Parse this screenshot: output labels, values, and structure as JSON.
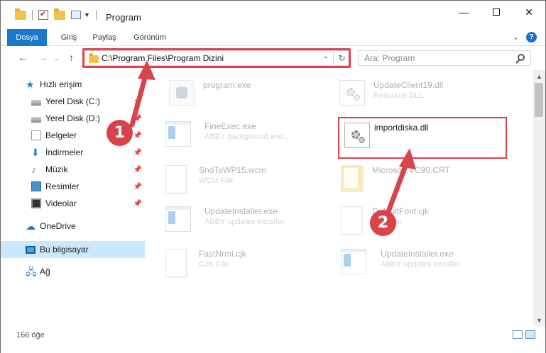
{
  "window": {
    "title": "Program",
    "min_glyph": "—",
    "close_glyph": "✕"
  },
  "ribbon": {
    "tabs": [
      "Dosya",
      "Giriş",
      "Paylaş",
      "Görünüm"
    ],
    "collapse_glyph": "⌄",
    "help_glyph": "?"
  },
  "nav": {
    "back_glyph": "←",
    "forward_glyph": "→",
    "recent_glyph": "⌄",
    "up_glyph": "↑",
    "address": "C:\\Program Files\\Program Dizini",
    "address_drop_glyph": "⌄",
    "refresh_glyph": "↻",
    "search_placeholder": "Ara: Program"
  },
  "sidebar": {
    "quick_access": "Hızlı erişim",
    "items": [
      {
        "label": "Yerel Disk (C:)",
        "icon": "disk-icon",
        "pinned": true
      },
      {
        "label": "Yerel Disk (D:)",
        "icon": "disk-icon",
        "pinned": true
      },
      {
        "label": "Belgeler",
        "icon": "documents-icon",
        "pinned": true
      },
      {
        "label": "İndirmeler",
        "icon": "download-icon",
        "pinned": true
      },
      {
        "label": "Müzik",
        "icon": "music-icon",
        "pinned": true
      },
      {
        "label": "Resimler",
        "icon": "pictures-icon",
        "pinned": true
      },
      {
        "label": "Videolar",
        "icon": "videos-icon",
        "pinned": true
      }
    ],
    "onedrive": "OneDrive",
    "this_pc": "Bu bilgisayar",
    "network": "Ağ",
    "pin_glyph": "📌"
  },
  "files": [
    {
      "name": "program.exe",
      "sub": "",
      "icon": "exe-icon",
      "faded": true
    },
    {
      "name": "UpdateClient19.dll",
      "sub": "Resource DLL",
      "icon": "dll-gear-icon",
      "faded": true
    },
    {
      "name": "FineExec.exe",
      "sub": "ABBY background exe...",
      "icon": "window-app-icon",
      "faded": true
    },
    {
      "name": "importdiska.dll",
      "sub": "",
      "icon": "dll-gear-icon",
      "faded": false
    },
    {
      "name": "SndToWP15.wcm",
      "sub": "WCM File",
      "icon": "blank-file-icon",
      "faded": true
    },
    {
      "name": "Microsoft.VC90.CRT",
      "sub": "",
      "icon": "folder-icon",
      "faded": true
    },
    {
      "name": "UpdateInstaller.exe",
      "sub": "ABBY updates installer",
      "icon": "window-app-icon",
      "faded": true
    },
    {
      "name": "DefaultFont.cjk",
      "sub": "CJK File",
      "icon": "blank-file-icon",
      "faded": true
    },
    {
      "name": "FastNrml.cjk",
      "sub": "CJK File",
      "icon": "blank-file-icon",
      "faded": true
    },
    {
      "name": "UpdateInstaller.exe",
      "sub": "ABBY updates installer",
      "icon": "window-app-icon",
      "faded": true
    }
  ],
  "annotations": {
    "step1": "1",
    "step2": "2",
    "accent": "#d8444b"
  },
  "status": {
    "count": "166 öğe"
  },
  "colors": {
    "file_tab": "#1979ca",
    "selection": "#cce8ff",
    "highlight": "#e0424b"
  }
}
